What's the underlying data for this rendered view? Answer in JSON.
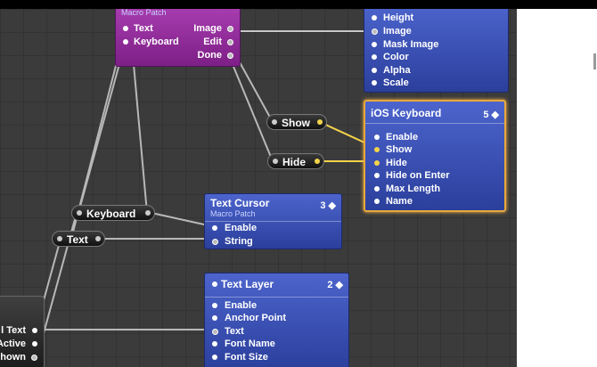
{
  "macro_patch": {
    "subtitle": "Macro Patch",
    "inputs": [
      "Text",
      "Keyboard"
    ],
    "outputs": [
      "Image",
      "Edit",
      "Done"
    ]
  },
  "top_right_patch": {
    "ports": [
      "Height",
      "Image",
      "Mask Image",
      "Color",
      "Alpha",
      "Scale"
    ]
  },
  "ios_keyboard": {
    "title": "iOS Keyboard",
    "number": "5 ◆",
    "ports": [
      "Enable",
      "Show",
      "Hide",
      "Hide on Enter",
      "Max Length",
      "Name"
    ]
  },
  "text_cursor": {
    "title": "Text Cursor",
    "subtitle": "Macro Patch",
    "number": "3 ◆",
    "ports": [
      "Enable",
      "String"
    ]
  },
  "text_layer": {
    "title": "Text Layer",
    "number": "2 ◆",
    "ports": [
      "Enable",
      "Anchor Point",
      "Text",
      "Font Name",
      "Font Size"
    ]
  },
  "left_patch": {
    "ports": [
      "l Text",
      "Active",
      "hown"
    ]
  },
  "pills": {
    "show": "Show",
    "hide": "Hide",
    "keyboard": "Keyboard",
    "text": "Text"
  },
  "colors": {
    "canvas": "#3b3b3b",
    "patch_blue": "#3a51b5",
    "macro_purple": "#952e9e",
    "highlight": "#e8a83a",
    "wire_active": "#f3d34a",
    "wire": "#b8b8b8"
  }
}
